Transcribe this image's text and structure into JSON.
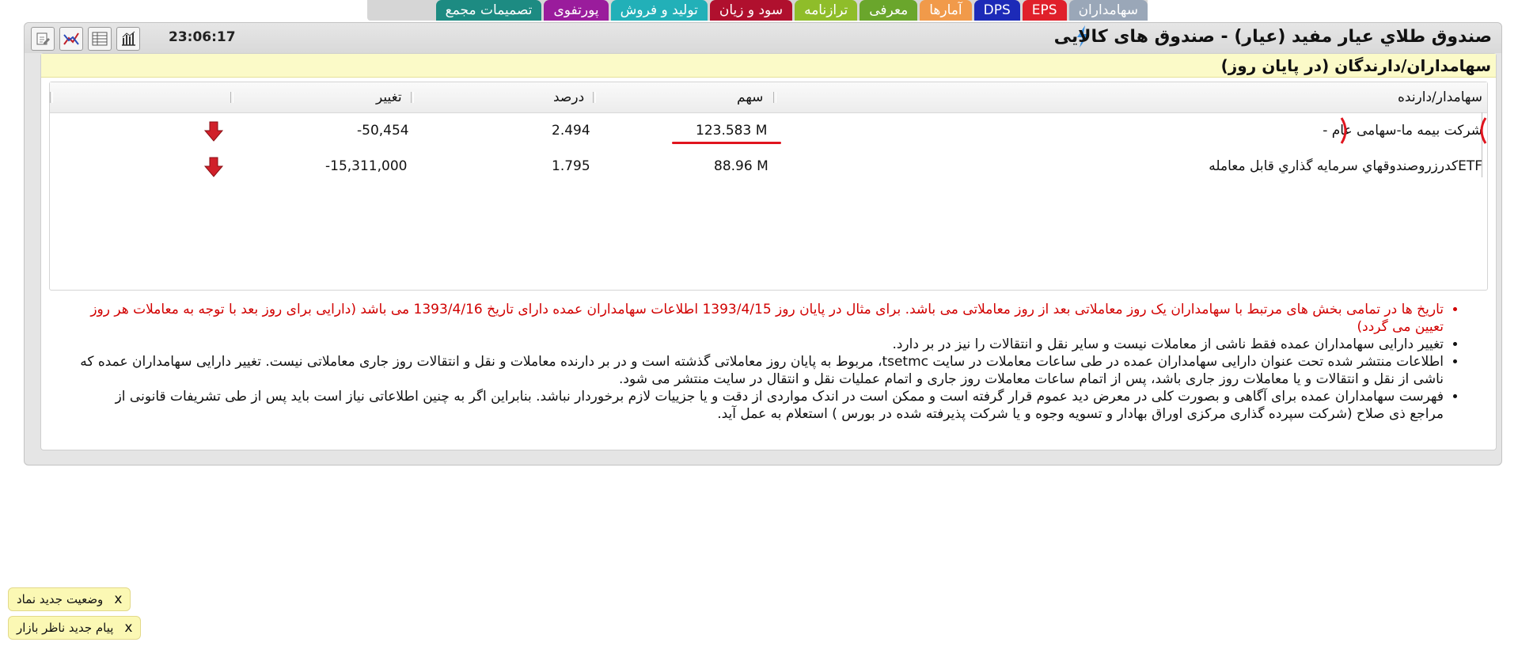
{
  "tabs": [
    {
      "label": "سهامداران",
      "color": "#9aa7b8"
    },
    {
      "label": "EPS",
      "color": "#e0202a"
    },
    {
      "label": "DPS",
      "color": "#1c2ab8"
    },
    {
      "label": "آمارها",
      "color": "#f19a4a"
    },
    {
      "label": "معرفی",
      "color": "#6aa62c"
    },
    {
      "label": "ترازنامه",
      "color": "#8fbd2a"
    },
    {
      "label": "سود و زیان",
      "color": "#b0102e"
    },
    {
      "label": "تولید و فروش",
      "color": "#22b0b8"
    },
    {
      "label": "پورتفوی",
      "color": "#9a1c9c"
    },
    {
      "label": "تصمیمات مجمع",
      "color": "#1d8b82"
    }
  ],
  "window": {
    "title": "صندوق طلاي عيار مفيد (عيار) - صندوق های کالایی",
    "time": "23:06:17"
  },
  "toolbar": {
    "icons": [
      "chart-icon",
      "grid-icon",
      "analysis-icon",
      "edit-icon"
    ]
  },
  "section": {
    "title": "سهامداران/دارندگان (در پایان روز)"
  },
  "table": {
    "headers": {
      "holder": "سهامدار/دارنده",
      "share": "سهم",
      "percent": "درصد",
      "change": "تغییر"
    },
    "rows": [
      {
        "holder": "شرکت بیمه ما-سهامی عام -",
        "share": "123.583 M",
        "percent": "2.494",
        "change": "-50,454",
        "trend": "down"
      },
      {
        "holder": "ETFکدرزروصندوقهاي سرمايه گذاري قابل معامله",
        "share": "88.96 M",
        "percent": "1.795",
        "change": "-15,311,000",
        "trend": "down"
      }
    ]
  },
  "notes": [
    "تاریخ ها در تمامی بخش های مرتبط با سهامداران یک روز معاملاتی بعد از روز معاملاتی می باشد. برای مثال در پایان روز 1393/4/15 اطلاعات سهامداران عمده دارای تاریخ 1393/4/16 می باشد (دارایی برای روز بعد با توجه به معاملات هر روز تعیین می گردد)",
    "تغییر دارایی سهامداران عمده فقط ناشی از معاملات نیست و سایر نقل و انتقالات را نیز در بر دارد.",
    "اطلاعات منتشر شده تحت عنوان دارایی سهامداران عمده در طی ساعات معاملات در سایت tsetmc، مربوط به پایان روز معاملاتی گذشته است و در بر دارنده معاملات و نقل و انتقالات روز جاری معاملاتی نیست. تغییر دارایی سهامداران عمده که ناشی از نقل و انتقالات و یا معاملات روز جاری باشد، پس از اتمام ساعات معاملات روز جاری و اتمام عملیات نقل و انتقال در سایت منتشر می شود.",
    "فهرست سهامداران عمده برای آگاهی و بصورت کلی در معرض دید عموم قرار گرفته است و ممکن است در اندک مواردی از دقت و یا جزییات لازم برخوردار نباشد. بنابراین اگر به چنین اطلاعاتی نیاز است باید پس از طی تشریفات قانونی از مراجع ذی صلاح (شرکت سپرده گذاری مرکزی اوراق بهادار و تسویه وجوه و یا شرکت پذیرفته شده در بورس ) استعلام به عمل آید."
  ],
  "toasts": [
    {
      "close": "x",
      "text": "وضعیت جدید نماد"
    },
    {
      "close": "x",
      "text": "پیام جدید ناظر بازار"
    }
  ],
  "colors": {
    "warning_text": "#d10000",
    "header_yellow": "#fbfac8",
    "down_arrow": "#d0202a",
    "annotation": "#e0141e"
  }
}
